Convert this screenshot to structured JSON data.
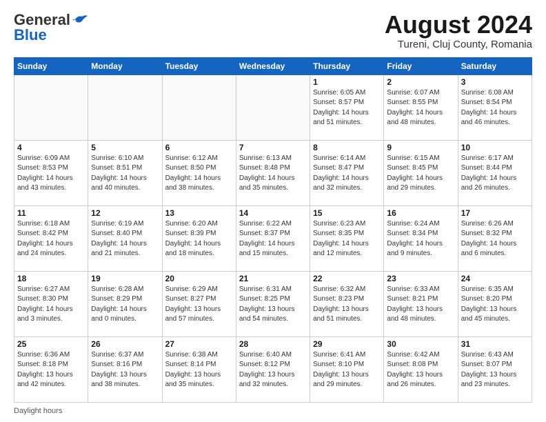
{
  "header": {
    "logo_general": "General",
    "logo_blue": "Blue",
    "month_year": "August 2024",
    "location": "Tureni, Cluj County, Romania"
  },
  "footer": {
    "daylight_label": "Daylight hours"
  },
  "weekdays": [
    "Sunday",
    "Monday",
    "Tuesday",
    "Wednesday",
    "Thursday",
    "Friday",
    "Saturday"
  ],
  "weeks": [
    [
      {
        "day": "",
        "info": ""
      },
      {
        "day": "",
        "info": ""
      },
      {
        "day": "",
        "info": ""
      },
      {
        "day": "",
        "info": ""
      },
      {
        "day": "1",
        "info": "Sunrise: 6:05 AM\nSunset: 8:57 PM\nDaylight: 14 hours and 51 minutes."
      },
      {
        "day": "2",
        "info": "Sunrise: 6:07 AM\nSunset: 8:55 PM\nDaylight: 14 hours and 48 minutes."
      },
      {
        "day": "3",
        "info": "Sunrise: 6:08 AM\nSunset: 8:54 PM\nDaylight: 14 hours and 46 minutes."
      }
    ],
    [
      {
        "day": "4",
        "info": "Sunrise: 6:09 AM\nSunset: 8:53 PM\nDaylight: 14 hours and 43 minutes."
      },
      {
        "day": "5",
        "info": "Sunrise: 6:10 AM\nSunset: 8:51 PM\nDaylight: 14 hours and 40 minutes."
      },
      {
        "day": "6",
        "info": "Sunrise: 6:12 AM\nSunset: 8:50 PM\nDaylight: 14 hours and 38 minutes."
      },
      {
        "day": "7",
        "info": "Sunrise: 6:13 AM\nSunset: 8:48 PM\nDaylight: 14 hours and 35 minutes."
      },
      {
        "day": "8",
        "info": "Sunrise: 6:14 AM\nSunset: 8:47 PM\nDaylight: 14 hours and 32 minutes."
      },
      {
        "day": "9",
        "info": "Sunrise: 6:15 AM\nSunset: 8:45 PM\nDaylight: 14 hours and 29 minutes."
      },
      {
        "day": "10",
        "info": "Sunrise: 6:17 AM\nSunset: 8:44 PM\nDaylight: 14 hours and 26 minutes."
      }
    ],
    [
      {
        "day": "11",
        "info": "Sunrise: 6:18 AM\nSunset: 8:42 PM\nDaylight: 14 hours and 24 minutes."
      },
      {
        "day": "12",
        "info": "Sunrise: 6:19 AM\nSunset: 8:40 PM\nDaylight: 14 hours and 21 minutes."
      },
      {
        "day": "13",
        "info": "Sunrise: 6:20 AM\nSunset: 8:39 PM\nDaylight: 14 hours and 18 minutes."
      },
      {
        "day": "14",
        "info": "Sunrise: 6:22 AM\nSunset: 8:37 PM\nDaylight: 14 hours and 15 minutes."
      },
      {
        "day": "15",
        "info": "Sunrise: 6:23 AM\nSunset: 8:35 PM\nDaylight: 14 hours and 12 minutes."
      },
      {
        "day": "16",
        "info": "Sunrise: 6:24 AM\nSunset: 8:34 PM\nDaylight: 14 hours and 9 minutes."
      },
      {
        "day": "17",
        "info": "Sunrise: 6:26 AM\nSunset: 8:32 PM\nDaylight: 14 hours and 6 minutes."
      }
    ],
    [
      {
        "day": "18",
        "info": "Sunrise: 6:27 AM\nSunset: 8:30 PM\nDaylight: 14 hours and 3 minutes."
      },
      {
        "day": "19",
        "info": "Sunrise: 6:28 AM\nSunset: 8:29 PM\nDaylight: 14 hours and 0 minutes."
      },
      {
        "day": "20",
        "info": "Sunrise: 6:29 AM\nSunset: 8:27 PM\nDaylight: 13 hours and 57 minutes."
      },
      {
        "day": "21",
        "info": "Sunrise: 6:31 AM\nSunset: 8:25 PM\nDaylight: 13 hours and 54 minutes."
      },
      {
        "day": "22",
        "info": "Sunrise: 6:32 AM\nSunset: 8:23 PM\nDaylight: 13 hours and 51 minutes."
      },
      {
        "day": "23",
        "info": "Sunrise: 6:33 AM\nSunset: 8:21 PM\nDaylight: 13 hours and 48 minutes."
      },
      {
        "day": "24",
        "info": "Sunrise: 6:35 AM\nSunset: 8:20 PM\nDaylight: 13 hours and 45 minutes."
      }
    ],
    [
      {
        "day": "25",
        "info": "Sunrise: 6:36 AM\nSunset: 8:18 PM\nDaylight: 13 hours and 42 minutes."
      },
      {
        "day": "26",
        "info": "Sunrise: 6:37 AM\nSunset: 8:16 PM\nDaylight: 13 hours and 38 minutes."
      },
      {
        "day": "27",
        "info": "Sunrise: 6:38 AM\nSunset: 8:14 PM\nDaylight: 13 hours and 35 minutes."
      },
      {
        "day": "28",
        "info": "Sunrise: 6:40 AM\nSunset: 8:12 PM\nDaylight: 13 hours and 32 minutes."
      },
      {
        "day": "29",
        "info": "Sunrise: 6:41 AM\nSunset: 8:10 PM\nDaylight: 13 hours and 29 minutes."
      },
      {
        "day": "30",
        "info": "Sunrise: 6:42 AM\nSunset: 8:08 PM\nDaylight: 13 hours and 26 minutes."
      },
      {
        "day": "31",
        "info": "Sunrise: 6:43 AM\nSunset: 8:07 PM\nDaylight: 13 hours and 23 minutes."
      }
    ]
  ]
}
